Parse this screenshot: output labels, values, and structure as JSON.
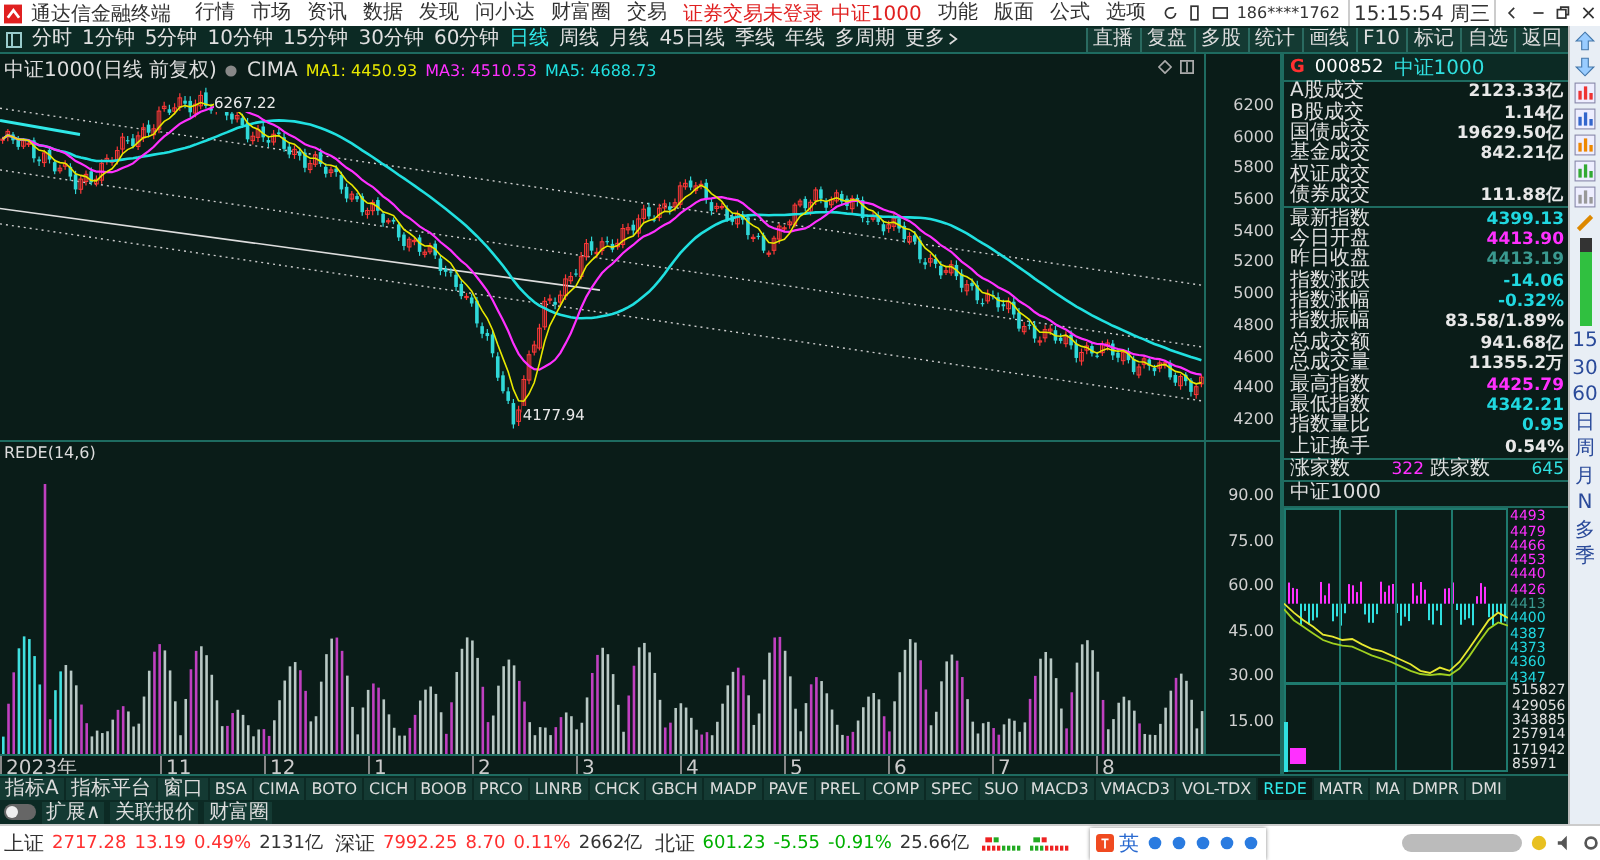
{
  "title_bar": {
    "app_name": "通达信金融终端",
    "menus": [
      "行情",
      "市场",
      "资讯",
      "数据",
      "发现",
      "问小达",
      "财富圈",
      "交易"
    ],
    "login_status": "证券交易未登录",
    "current_symbol": "中证1000",
    "tools": [
      "功能",
      "版面",
      "公式",
      "选项"
    ],
    "account": "186****1762",
    "clock": "15:15:54 周三"
  },
  "period_tabs": [
    {
      "label": "分时",
      "selected": false
    },
    {
      "label": "1分钟",
      "selected": false
    },
    {
      "label": "5分钟",
      "selected": false
    },
    {
      "label": "10分钟",
      "selected": false
    },
    {
      "label": "15分钟",
      "selected": false
    },
    {
      "label": "30分钟",
      "selected": false
    },
    {
      "label": "60分钟",
      "selected": false
    },
    {
      "label": "日线",
      "selected": true
    },
    {
      "label": "周线",
      "selected": false
    },
    {
      "label": "月线",
      "selected": false
    },
    {
      "label": "45日线",
      "selected": false
    },
    {
      "label": "季线",
      "selected": false
    },
    {
      "label": "年线",
      "selected": false
    },
    {
      "label": "多周期",
      "selected": false
    },
    {
      "label": "更多",
      "selected": false
    }
  ],
  "chart_buttons": [
    "直播",
    "复盘",
    "多股",
    "统计",
    "画线",
    "F10",
    "标记",
    "自选",
    "返回"
  ],
  "main_chart": {
    "title": "中证1000(日线 前复权)",
    "indicator": "CIMA",
    "ma_lines": [
      {
        "label": "MA1: 4450.93",
        "color": "#e8e800"
      },
      {
        "label": "MA3: 4510.53",
        "color": "#ff30ff"
      },
      {
        "label": "MA5: 4688.73",
        "color": "#20e0e0"
      }
    ],
    "high_label": "6267.22",
    "low_label": "4177.94",
    "price_axis": [
      "6200",
      "6000",
      "5800",
      "5600",
      "5400",
      "5200",
      "5000",
      "4800",
      "4600",
      "4400",
      "4200"
    ]
  },
  "indicator_panel": {
    "title": "REDE(14,6)",
    "axis": [
      "90.00",
      "75.00",
      "60.00",
      "45.00",
      "30.00",
      "15.00"
    ]
  },
  "x_axis": [
    "2023年",
    "11",
    "12",
    "1",
    "2",
    "3",
    "4",
    "5",
    "6",
    "7",
    "8"
  ],
  "quote_panel": {
    "market": "G",
    "code": "000852",
    "name": "中证1000",
    "market_stats": [
      {
        "label": "A股成交",
        "value": "2123.33亿",
        "color": "#e8e8e8"
      },
      {
        "label": "B股成交",
        "value": "1.14亿",
        "color": "#e8e8e8"
      },
      {
        "label": "国债成交",
        "value": "19629.50亿",
        "color": "#e8e8e8"
      },
      {
        "label": "基金成交",
        "value": "842.21亿",
        "color": "#e8e8e8"
      },
      {
        "label": "权证成交"
      },
      {
        "label": "债券成交",
        "value": "111.88亿",
        "color": "#e8e8e8"
      }
    ],
    "index_stats": [
      {
        "label": "最新指数",
        "value": "4399.13",
        "color": "#20d8e0"
      },
      {
        "label": "今日开盘",
        "value": "4413.90",
        "color": "#ff30ff"
      },
      {
        "label": "昨日收盘",
        "value": "4413.19",
        "color": "#3a9a90"
      },
      {
        "label": "指数涨跌",
        "value": "-14.06",
        "color": "#20d8e0"
      },
      {
        "label": "指数涨幅",
        "value": "-0.32%",
        "color": "#20d8e0"
      },
      {
        "label": "指数振幅",
        "value": "83.58/1.89%",
        "color": "#e8e8e8"
      },
      {
        "label": "总成交额",
        "value": "941.68亿",
        "color": "#e8e8e8"
      },
      {
        "label": "总成交量",
        "value": "11355.2万",
        "color": "#e8e8e8"
      },
      {
        "label": "最高指数",
        "value": "4425.79",
        "color": "#ff30ff"
      },
      {
        "label": "最低指数",
        "value": "4342.21",
        "color": "#20d8e0"
      },
      {
        "label": "指数量比",
        "value": "0.95",
        "color": "#20d8e0"
      },
      {
        "label": "上证换手",
        "value": "0.54%",
        "color": "#e8e8e8"
      }
    ],
    "advancers_label": "涨家数",
    "advancers": "322",
    "decliners_label": "跌家数",
    "decliners": "645"
  },
  "intraday": {
    "title": "中证1000",
    "volume_axis": [
      "515827",
      "429056",
      "343885",
      "257914",
      "171942",
      "85971"
    ],
    "chart_data": {
      "type": "line",
      "ylim": [
        4340,
        4500
      ],
      "yticks": [
        4493,
        4479,
        4466,
        4453,
        4440,
        4426,
        4413,
        4400,
        4387,
        4373,
        4360,
        4347
      ],
      "series": [
        {
          "color": "#e8e830",
          "values": [
            4413,
            4405,
            4398,
            4392,
            4385,
            4383,
            4380,
            4381,
            4376,
            4372,
            4370,
            4366,
            4362,
            4358,
            4352,
            4350,
            4355,
            4352,
            4360,
            4372,
            4385,
            4398,
            4405,
            4400
          ]
        },
        {
          "color": "#a0d020",
          "values": [
            4408,
            4398,
            4392,
            4386,
            4380,
            4377,
            4375,
            4374,
            4370,
            4366,
            4363,
            4360,
            4356,
            4352,
            4349,
            4348,
            4349,
            4348,
            4354,
            4365,
            4378,
            4390,
            4396,
            4393
          ]
        }
      ]
    }
  },
  "side_toolbar": {
    "labels": [
      "15",
      "30",
      "60",
      "日",
      "周",
      "月",
      "N",
      "多",
      "季"
    ]
  },
  "indicator_tabs": [
    {
      "label": "指标A",
      "selected": false
    },
    {
      "label": "指标平台",
      "selected": false
    },
    {
      "label": "窗口",
      "selected": false
    },
    {
      "label": "BSA",
      "selected": false
    },
    {
      "label": "CIMA",
      "selected": false
    },
    {
      "label": "BOTO",
      "selected": false
    },
    {
      "label": "CICH",
      "selected": false
    },
    {
      "label": "BOOB",
      "selected": false
    },
    {
      "label": "PRCO",
      "selected": false
    },
    {
      "label": "LINRB",
      "selected": false
    },
    {
      "label": "CHCK",
      "selected": false
    },
    {
      "label": "GBCH",
      "selected": false
    },
    {
      "label": "MADP",
      "selected": false
    },
    {
      "label": "PAVE",
      "selected": false
    },
    {
      "label": "PREL",
      "selected": false
    },
    {
      "label": "COMP",
      "selected": false
    },
    {
      "label": "SPEC",
      "selected": false
    },
    {
      "label": "SUO",
      "selected": false
    },
    {
      "label": "MACD3",
      "selected": false
    },
    {
      "label": "VMACD3",
      "selected": false
    },
    {
      "label": "VOL-TDX",
      "selected": false
    },
    {
      "label": "REDE",
      "selected": true
    },
    {
      "label": "MATR",
      "selected": false
    },
    {
      "label": "MA",
      "selected": false
    },
    {
      "label": "DMPR",
      "selected": false
    },
    {
      "label": "DMI",
      "selected": false
    }
  ],
  "extension_row": {
    "toggle_on": false,
    "items": [
      "扩展∧",
      "关联报价",
      "财富圈"
    ]
  },
  "status_bar": {
    "indices": [
      {
        "name": "上证",
        "price": "2717.28",
        "change": "13.19",
        "percent": "0.49%",
        "amount": "2131亿",
        "color": "#ff3030"
      },
      {
        "name": "深证",
        "price": "7992.25",
        "change": "8.70",
        "percent": "0.11%",
        "amount": "2662亿",
        "color": "#ff3030"
      },
      {
        "name": "北证",
        "price": "601.23",
        "change": "-5.55",
        "percent": "-0.91%",
        "amount": "25.66亿",
        "color": "#00b000"
      }
    ],
    "ime_language": "英"
  }
}
